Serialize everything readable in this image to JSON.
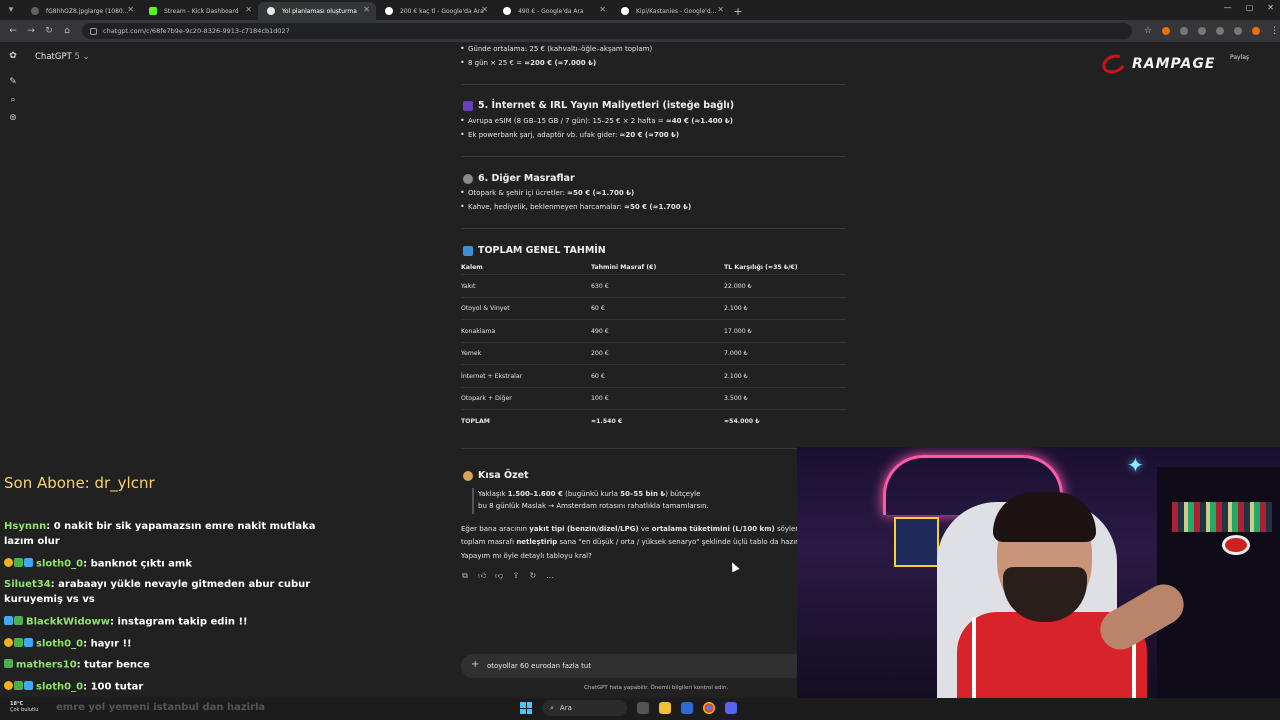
{
  "browser": {
    "tabs": [
      {
        "label": "fG8hhOZ8.jpglarge (1080×1350)",
        "icon": "image-icon",
        "active": false
      },
      {
        "label": "Stream - Kick Dashboard",
        "icon": "kick-icon",
        "active": false
      },
      {
        "label": "Yol planlaması oluşturma",
        "icon": "chatgpt-icon",
        "active": true
      },
      {
        "label": "200 € kaç tl - Google'da Ara",
        "icon": "google-icon",
        "active": false
      },
      {
        "label": "490 € - Google'da Ara",
        "icon": "google-icon",
        "active": false
      },
      {
        "label": "Kipi/Kastanies - Google'da Ara",
        "icon": "google-icon",
        "active": false
      }
    ],
    "url": "chatgpt.com/c/68fe7b9e-9c20-8326-9913-c7184cb1d027"
  },
  "chatgpt": {
    "model_label": "ChatGPT",
    "model_version": "5 ⌄",
    "share_label": "Paylaş",
    "brand": "RAMPAGE",
    "food_bullets": [
      {
        "text": "Günde ortalama: 25 € (kahvaltı–öğle–akşam toplam)"
      },
      {
        "pre": "8 gün × 25 € = ",
        "bold": "≈200 € (≈7.000 ₺)"
      }
    ],
    "section5_title": "5. İnternet & IRL Yayın Maliyetleri (isteğe bağlı)",
    "section5_bullets": [
      {
        "pre": "Avrupa eSIM (8 GB–15 GB / 7 gün): 15–25 € × 2 hafta = ",
        "bold": "≈40 € (≈1.400 ₺)"
      },
      {
        "pre": "Ek powerbank şarj, adaptör vb. ufak gider: ",
        "bold": "≈20 € (≈700 ₺)"
      }
    ],
    "section6_title": "6. Diğer Masraflar",
    "section6_bullets": [
      {
        "pre": "Otopark & şehir içi ücretler: ",
        "bold": "≈50 € (≈1.700 ₺)"
      },
      {
        "pre": "Kahve, hediyelik, beklenmeyen harcamalar: ",
        "bold": "≈50 € (≈1.700 ₺)"
      }
    ],
    "total_title": "TOPLAM GENEL TAHMİN",
    "table": {
      "headers": [
        "Kalem",
        "Tahmini Masraf (€)",
        "TL Karşılığı (≈35 ₺/€)"
      ],
      "rows": [
        [
          "Yakıt",
          "630 €",
          "22.000 ₺"
        ],
        [
          "Otoyol & Vinyet",
          "60 €",
          "2.100 ₺"
        ],
        [
          "Konaklama",
          "490 €",
          "17.000 ₺"
        ],
        [
          "Yemek",
          "200 €",
          "7.000 ₺"
        ],
        [
          "İnternet + Ekstralar",
          "60 €",
          "2.100 ₺"
        ],
        [
          "Otopark + Diğer",
          "100 €",
          "3.500 ₺"
        ],
        [
          "TOPLAM",
          "≈1.540 €",
          "≈54.000 ₺"
        ]
      ]
    },
    "summary_title": "Kısa Özet",
    "summary_line1_pre": "Yaklaşık ",
    "summary_line1_b1": "1.500–1.600 €",
    "summary_line1_mid": " (bugünkü kurla ",
    "summary_line1_b2": "50–55 bin ₺",
    "summary_line1_post": ") bütçeyle",
    "summary_line2": "bu 8 günlük Maslak → Amsterdam rotasını rahatlıkla tamamlarsın.",
    "para_line1_pre": "Eğer bana aracının ",
    "para_line1_b1": "yakıt tipi (benzin/dizel/LPG)",
    "para_line1_mid": " ve ",
    "para_line1_b2": "ortalama tüketimini (L/100 km)",
    "para_line1_post": " söylersen, y",
    "para_line2_pre": "toplam masrafı ",
    "para_line2_b": "netleştirip",
    "para_line2_post": " sana \"en düşük / orta / yüksek senaryo\" şeklinde üçlü tablo da hazırla",
    "para_line3": "Yapayım mı öyle detaylı tabloyu kral?",
    "composer_value": "otoyollar 60 eurodan fazla tut",
    "disclaimer": "ChatGPT hata yapabilir. Önemli bilgileri kontrol edin."
  },
  "stream": {
    "last_sub": "Son Abone: dr_ylcnr",
    "chat": [
      {
        "user": "Hsynnn",
        "msg": "0 nakit bir sik yapamazsın emre nakit mutlaka lazım olur",
        "badges": []
      },
      {
        "user": "sloth0_0",
        "msg": "banknot çıktı amk",
        "badges": [
          "gold",
          "green",
          "blue"
        ]
      },
      {
        "user": "Siluet34",
        "msg": "arabaayı yükle nevayle gitmeden abur cubur kuruyemiş vs vs",
        "badges": []
      },
      {
        "user": "BlackkWidoww",
        "msg": "instagram takip edin !!",
        "badges": [
          "blue",
          "green"
        ]
      },
      {
        "user": "sloth0_0",
        "msg": "hayır !!",
        "badges": [
          "gold",
          "green",
          "blue"
        ]
      },
      {
        "user": "mathers10",
        "msg": "tutar bence",
        "badges": [
          "green"
        ]
      },
      {
        "user": "sloth0_0",
        "msg": "100 tutar",
        "badges": [
          "gold",
          "green",
          "blue"
        ]
      }
    ],
    "faded_line": "emre yol yemeni istanbul dan hazirla"
  },
  "taskbar": {
    "temp": "18°C",
    "weather": "Çok bulutlu",
    "search": "Ara"
  }
}
